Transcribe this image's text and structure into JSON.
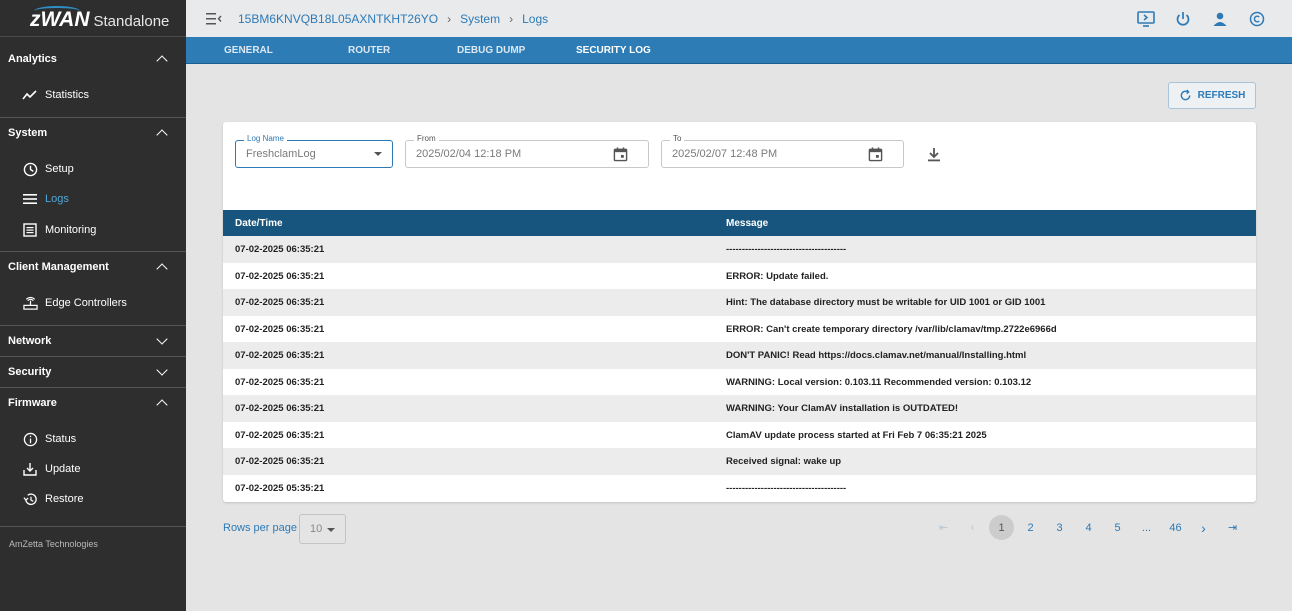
{
  "app": {
    "brand": "zWAN",
    "brand_suffix": "Standalone",
    "company": "AmZetta Technologies"
  },
  "breadcrumb": [
    "15BM6KNVQB18L05AXNTKHT26YO",
    "System",
    "Logs"
  ],
  "sidebar": {
    "analytics": "Analytics",
    "statistics": "Statistics",
    "system": "System",
    "setup": "Setup",
    "logs": "Logs",
    "monitoring": "Monitoring",
    "client_management": "Client Management",
    "edge_controllers": "Edge Controllers",
    "network": "Network",
    "security": "Security",
    "firmware": "Firmware",
    "status": "Status",
    "update": "Update",
    "restore": "Restore"
  },
  "tabs": [
    "GENERAL",
    "ROUTER",
    "DEBUG DUMP",
    "SECURITY LOG"
  ],
  "refresh_label": "REFRESH",
  "filters": {
    "log_name_label": "Log Name",
    "log_name_value": "FreshclamLog",
    "from_label": "From",
    "from_value": "2025/02/04 12:18 PM",
    "to_label": "To",
    "to_value": "2025/02/07 12:48 PM"
  },
  "table": {
    "headers": [
      "Date/Time",
      "Message"
    ],
    "rows": [
      [
        "07-02-2025 06:35:21",
        "--------------------------------------"
      ],
      [
        "07-02-2025 06:35:21",
        "ERROR: Update failed."
      ],
      [
        "07-02-2025 06:35:21",
        "Hint: The database directory must be writable for UID 1001 or GID 1001"
      ],
      [
        "07-02-2025 06:35:21",
        "ERROR: Can't create temporary directory /var/lib/clamav/tmp.2722e6966d"
      ],
      [
        "07-02-2025 06:35:21",
        "DON'T PANIC! Read https://docs.clamav.net/manual/Installing.html"
      ],
      [
        "07-02-2025 06:35:21",
        "WARNING: Local version: 0.103.11 Recommended version: 0.103.12"
      ],
      [
        "07-02-2025 06:35:21",
        "WARNING: Your ClamAV installation is OUTDATED!"
      ],
      [
        "07-02-2025 06:35:21",
        "ClamAV update process started at Fri Feb 7 06:35:21 2025"
      ],
      [
        "07-02-2025 06:35:21",
        "Received signal: wake up"
      ],
      [
        "07-02-2025 05:35:21",
        "--------------------------------------"
      ]
    ]
  },
  "pagination": {
    "rows_per_page_label": "Rows per page",
    "rows_per_page": "10",
    "pages": [
      "1",
      "2",
      "3",
      "4",
      "5",
      "...",
      "46"
    ],
    "current": "1"
  },
  "icons": [
    "menu-collapse-icon",
    "chevron-right-icon",
    "remote-desktop-icon",
    "power-icon",
    "user-icon",
    "copyright-icon",
    "refresh-icon",
    "calendar-icon",
    "download-icon",
    "first-page-icon",
    "prev-page-icon",
    "next-page-icon",
    "last-page-icon"
  ],
  "colors": {
    "accent": "#2d7ab6",
    "header": "#17557e",
    "sidebar": "#2e2e2e"
  }
}
